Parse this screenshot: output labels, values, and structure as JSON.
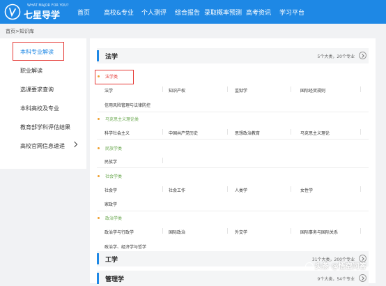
{
  "header": {
    "logo_tagline": "WHAT MAJOR FOR YOU?",
    "logo_text": "七星导学",
    "nav": [
      "首页",
      "高校&专业",
      "个人测评",
      "综合报告",
      "录取概率预测",
      "高考资讯",
      "学习平台"
    ]
  },
  "breadcrumb": "首页>知识库",
  "sidebar": {
    "items": [
      "本科专业解读",
      "职业解读",
      "选课要求查询",
      "本科高校及专业",
      "教育部学科评估结果",
      "高校官网信息速递"
    ],
    "active": "本科专业解读"
  },
  "categories": [
    {
      "title": "法学",
      "count": "5个大类，20个专业",
      "subcategories": [
        {
          "name": "法学类",
          "majors": [
            "法学",
            "知识产权",
            "监狱学",
            "国际经贸规则",
            "信用风险管理与法律防控"
          ]
        },
        {
          "name": "马克思主义理论类",
          "majors": [
            "科学社会主义",
            "中国共产党历史",
            "思想政治教育",
            "马克思主义理论"
          ]
        },
        {
          "name": "民族学类",
          "majors": [
            "民族学"
          ]
        },
        {
          "name": "社会学类",
          "majors": [
            "社会学",
            "社会工作",
            "人类学",
            "女性学",
            "家政学"
          ]
        },
        {
          "name": "政治学类",
          "majors": [
            "政治学与行政学",
            "国际政治",
            "外交学",
            "国际事务与国际关系",
            "政治学、经济学与哲学"
          ]
        }
      ]
    },
    {
      "title": "工学",
      "count": "31个大类，200个专业"
    },
    {
      "title": "管理学",
      "count": "9个大类，54个专业"
    }
  ],
  "watermark": "头条 @悟空问答",
  "colors": {
    "brand_blue": "#1e88e5",
    "highlight_red": "#e53935",
    "subcategory_green": "#6aa84f",
    "bullet_orange": "#f0a030"
  }
}
